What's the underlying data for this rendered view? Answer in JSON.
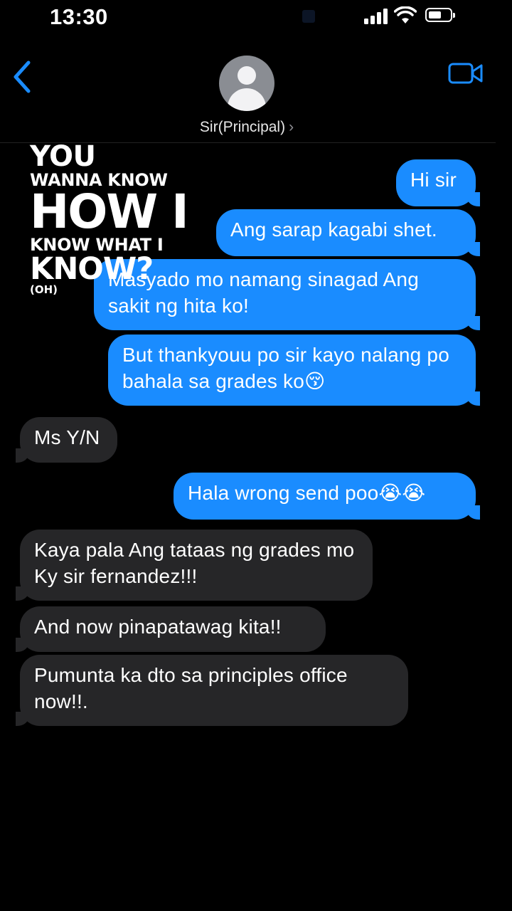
{
  "status_bar": {
    "time": "13:30",
    "icons": [
      "signal-icon",
      "wifi-icon",
      "battery-icon"
    ]
  },
  "nav": {
    "back_icon": "chevron-left-icon",
    "video_icon": "video-camera-icon",
    "contact_name": "Sir(Principal)",
    "contact_chevron": "›"
  },
  "colors": {
    "background": "#000000",
    "outgoing_bubble": "#1a8cff",
    "incoming_bubble": "#262628",
    "accent": "#1a8cff"
  },
  "messages": [
    {
      "direction": "out",
      "text": "Hi sir"
    },
    {
      "direction": "out",
      "text": "Ang sarap kagabi shet."
    },
    {
      "direction": "out",
      "text": "Masyado mo namang sinagad Ang sakit ng hita ko!"
    },
    {
      "direction": "out",
      "text": "But thankyouu po sir kayo nalang po bahala sa grades ko",
      "emoji": "😚"
    },
    {
      "direction": "in",
      "text": "Ms Y/N"
    },
    {
      "direction": "out",
      "text": "Hala wrong send poo",
      "emoji": "😭😭"
    },
    {
      "direction": "in",
      "text": "Kaya pala Ang tataas ng grades mo Ky sir fernandez!!!"
    },
    {
      "direction": "in",
      "text": "And now pinapatawag kita!!"
    },
    {
      "direction": "in",
      "text": "Pumunta ka dto sa principles office now!!."
    }
  ],
  "overlay_caption": {
    "line1": "YOU",
    "line2": "WANNA KNOW",
    "line3": "HOW I",
    "line4": "KNOW WHAT I",
    "line5": "KNOW?",
    "line6": "(OH)"
  }
}
